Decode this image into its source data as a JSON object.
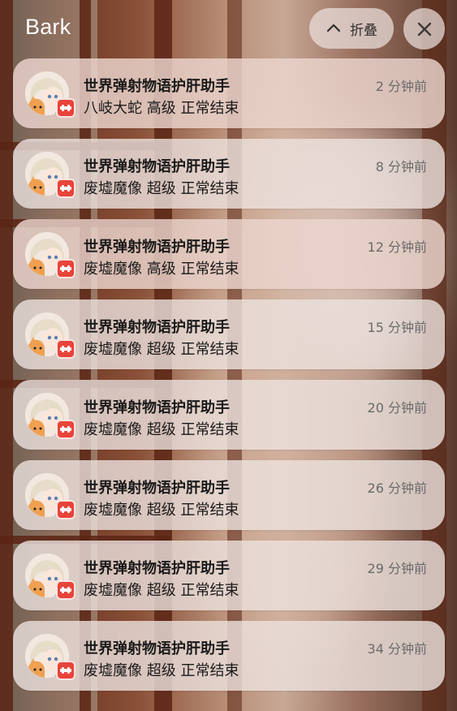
{
  "header": {
    "app_name": "Bark",
    "collapse_label": "折叠"
  },
  "colors": {
    "badge": "#e8443a",
    "card": "#ece2de",
    "title_text": "#1a1a1a",
    "time_text": "#6a6a6a"
  },
  "notifications": [
    {
      "title": "世界弹射物语护肝助手",
      "body": "八岐大蛇 高级 正常结束",
      "time": "2 分钟前"
    },
    {
      "title": "世界弹射物语护肝助手",
      "body": "废墟魔像 超级 正常结束",
      "time": "8 分钟前"
    },
    {
      "title": "世界弹射物语护肝助手",
      "body": "废墟魔像 高级  正常结束",
      "time": "12 分钟前"
    },
    {
      "title": "世界弹射物语护肝助手",
      "body": "废墟魔像 超级 正常结束",
      "time": "15 分钟前"
    },
    {
      "title": "世界弹射物语护肝助手",
      "body": "废墟魔像 超级 正常结束",
      "time": "20 分钟前"
    },
    {
      "title": "世界弹射物语护肝助手",
      "body": "废墟魔像 超级 正常结束",
      "time": "26 分钟前"
    },
    {
      "title": "世界弹射物语护肝助手",
      "body": "废墟魔像 超级 正常结束",
      "time": "29 分钟前"
    },
    {
      "title": "世界弹射物语护肝助手",
      "body": "废墟魔像 超级 正常结束",
      "time": "34 分钟前"
    }
  ]
}
